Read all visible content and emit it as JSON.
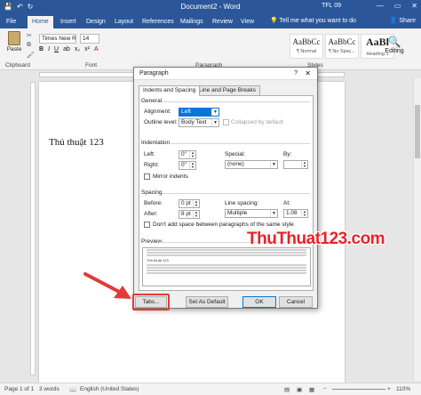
{
  "titlebar": {
    "doc_title": "Document2 - Word",
    "user": "TFL 09",
    "minimize": "—",
    "restore": "▭",
    "close": "✕"
  },
  "ribbon_tabs": [
    "File",
    "Home",
    "Insert",
    "Design",
    "Layout",
    "References",
    "Mailings",
    "Review",
    "View"
  ],
  "tell_me": "Tell me what you want to do",
  "share": "Share",
  "ribbon": {
    "paste_label": "Paste",
    "clipboard_label": "Clipboard",
    "font_name": "Times New Ro",
    "font_size": "14",
    "font_label": "Font",
    "paragraph_label": "Paragraph",
    "styles_label": "Styles",
    "styles": [
      {
        "sample": "AaBbCc",
        "name": "¶ Normal"
      },
      {
        "sample": "AaBbCc",
        "name": "¶ No Spac..."
      },
      {
        "sample": "AaBl",
        "name": "Heading 1"
      }
    ],
    "editing_label": "Editing"
  },
  "document": {
    "text": "Thủ thuật 123"
  },
  "dialog": {
    "title": "Paragraph",
    "help": "?",
    "close": "✕",
    "tabs": [
      "Indents and Spacing",
      "Line and Page Breaks"
    ],
    "general": {
      "heading": "General",
      "alignment_label": "Alignment:",
      "alignment_value": "Left",
      "outline_label": "Outline level:",
      "outline_value": "Body Text",
      "collapsed_label": "Collapsed by default"
    },
    "indentation": {
      "heading": "Indentation",
      "left_label": "Left:",
      "left_value": "0\"",
      "right_label": "Right:",
      "right_value": "0\"",
      "special_label": "Special:",
      "special_value": "(none)",
      "by_label": "By:",
      "mirror_label": "Mirror indents"
    },
    "spacing": {
      "heading": "Spacing",
      "before_label": "Before:",
      "before_value": "0 pt",
      "after_label": "After:",
      "after_value": "8 pt",
      "line_spacing_label": "Line spacing:",
      "line_spacing_value": "Multiple",
      "at_label": "At:",
      "at_value": "1.08",
      "dont_add_label": "Don't add space between paragraphs of the same style"
    },
    "preview": {
      "heading": "Preview",
      "sample_text": "Thủ thuật 123"
    },
    "buttons": {
      "tabs": "Tabs...",
      "set_default": "Set As Default",
      "ok": "OK",
      "cancel": "Cancel"
    }
  },
  "watermark": "ThuThuat123.com",
  "statusbar": {
    "page": "Page 1 of 1",
    "words": "3 words",
    "language": "English (United States)",
    "zoom": "110%"
  },
  "colors": {
    "word_blue": "#2b579a",
    "annotation_red": "#e53935",
    "watermark_red": "#e8232a"
  }
}
